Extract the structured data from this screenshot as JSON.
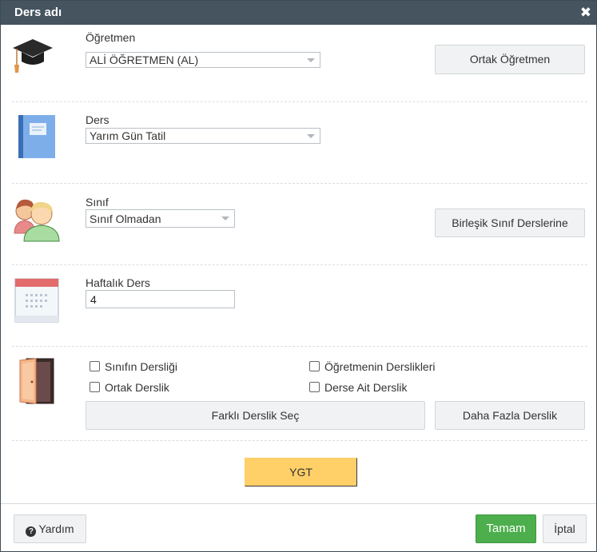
{
  "dialog": {
    "title": "Ders adı",
    "close_label": "✖"
  },
  "teacher": {
    "label": "Öğretmen",
    "selected": "ALİ ÖĞRETMEN (AL)",
    "shared_button": "Ortak Öğretmen",
    "icon": "graduation-cap-icon"
  },
  "lesson": {
    "label": "Ders",
    "selected": "Yarım Gün Tatil",
    "icon": "book-icon"
  },
  "class": {
    "label": "Sınıf",
    "selected": "Sınıf Olmadan",
    "joint_button": "Birleşik Sınıf Derslerine",
    "icon": "students-icon"
  },
  "weekly": {
    "label": "Haftalık Ders",
    "value": "4",
    "icon": "calendar-icon"
  },
  "classroom": {
    "icon": "door-icon",
    "options": [
      {
        "label": "Sınıfın Dersliği",
        "checked": false
      },
      {
        "label": "Öğretmenin Derslikleri",
        "checked": false
      },
      {
        "label": "Ortak Derslik",
        "checked": false
      },
      {
        "label": "Derse Ait Derslik",
        "checked": false
      }
    ],
    "choose_button": "Farklı Derslik Seç",
    "more_button": "Daha Fazla Derslik"
  },
  "ygt_button": "YGT",
  "footer": {
    "help_label": "Yardım",
    "ok_label": "Tamam",
    "cancel_label": "İptal"
  },
  "colors": {
    "titlebar": "#45545f",
    "ygt": "#ffcf68",
    "ok": "#4cae4c"
  }
}
